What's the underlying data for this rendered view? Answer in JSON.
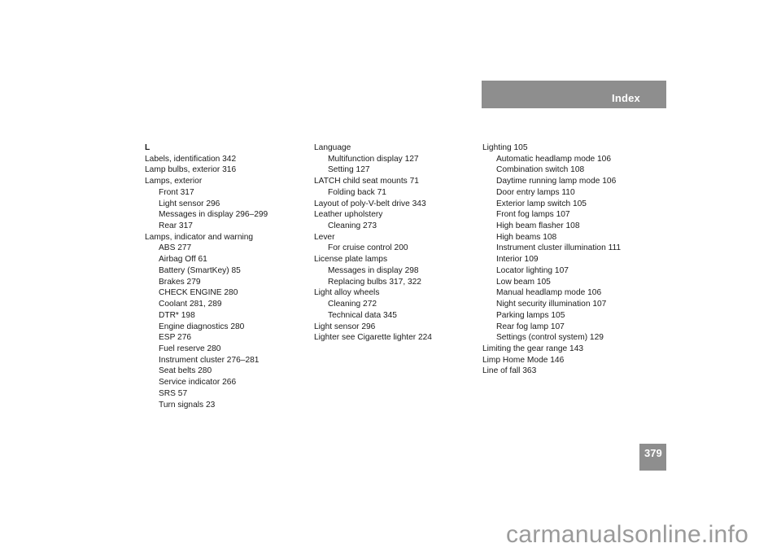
{
  "header": {
    "title": "Index"
  },
  "page_number": "379",
  "watermark": "carmanualsonline.info",
  "columns": [
    {
      "entries": [
        {
          "text": "L",
          "level": "letter"
        },
        {
          "text": "Labels, identification 342",
          "level": "main"
        },
        {
          "text": "Lamp bulbs, exterior 316",
          "level": "main"
        },
        {
          "text": "Lamps, exterior",
          "level": "main"
        },
        {
          "text": "Front 317",
          "level": "sub"
        },
        {
          "text": "Light sensor 296",
          "level": "sub"
        },
        {
          "text": "Messages in display 296–299",
          "level": "sub"
        },
        {
          "text": "Rear 317",
          "level": "sub"
        },
        {
          "text": "Lamps, indicator and warning",
          "level": "main"
        },
        {
          "text": "ABS 277",
          "level": "sub"
        },
        {
          "text": "Airbag Off 61",
          "level": "sub"
        },
        {
          "text": "Battery (SmartKey) 85",
          "level": "sub"
        },
        {
          "text": "Brakes 279",
          "level": "sub"
        },
        {
          "text": "CHECK ENGINE 280",
          "level": "sub"
        },
        {
          "text": "Coolant 281, 289",
          "level": "sub"
        },
        {
          "text": "DTR* 198",
          "level": "sub"
        },
        {
          "text": "Engine diagnostics 280",
          "level": "sub"
        },
        {
          "text": "ESP 276",
          "level": "sub"
        },
        {
          "text": "Fuel reserve 280",
          "level": "sub"
        },
        {
          "text": "Instrument cluster 276–281",
          "level": "sub"
        },
        {
          "text": "Seat belts 280",
          "level": "sub"
        },
        {
          "text": "Service indicator 266",
          "level": "sub"
        },
        {
          "text": "SRS 57",
          "level": "sub"
        },
        {
          "text": "Turn signals 23",
          "level": "sub"
        }
      ]
    },
    {
      "entries": [
        {
          "text": "Language",
          "level": "main"
        },
        {
          "text": "Multifunction display 127",
          "level": "sub"
        },
        {
          "text": "Setting 127",
          "level": "sub"
        },
        {
          "text": "LATCH child seat mounts 71",
          "level": "main"
        },
        {
          "text": "Folding back 71",
          "level": "sub"
        },
        {
          "text": "Layout of poly-V-belt drive 343",
          "level": "main"
        },
        {
          "text": "Leather upholstery",
          "level": "main"
        },
        {
          "text": "Cleaning 273",
          "level": "sub"
        },
        {
          "text": "Lever",
          "level": "main"
        },
        {
          "text": "For cruise control 200",
          "level": "sub"
        },
        {
          "text": "License plate lamps",
          "level": "main"
        },
        {
          "text": "Messages in display 298",
          "level": "sub"
        },
        {
          "text": "Replacing bulbs 317, 322",
          "level": "sub"
        },
        {
          "text": "Light alloy wheels",
          "level": "main"
        },
        {
          "text": "Cleaning 272",
          "level": "sub"
        },
        {
          "text": "Technical data 345",
          "level": "sub"
        },
        {
          "text": "Light sensor 296",
          "level": "main"
        },
        {
          "text": "Lighter see Cigarette lighter 224",
          "level": "main"
        }
      ]
    },
    {
      "entries": [
        {
          "text": "Lighting 105",
          "level": "main"
        },
        {
          "text": "Automatic headlamp mode 106",
          "level": "sub"
        },
        {
          "text": "Combination switch 108",
          "level": "sub"
        },
        {
          "text": "Daytime running lamp mode 106",
          "level": "sub"
        },
        {
          "text": "Door entry lamps 110",
          "level": "sub"
        },
        {
          "text": "Exterior lamp switch 105",
          "level": "sub"
        },
        {
          "text": "Front fog lamps 107",
          "level": "sub"
        },
        {
          "text": "High beam flasher 108",
          "level": "sub"
        },
        {
          "text": "High beams 108",
          "level": "sub"
        },
        {
          "text": "Instrument cluster illumination 111",
          "level": "sub"
        },
        {
          "text": "Interior 109",
          "level": "sub"
        },
        {
          "text": "Locator lighting 107",
          "level": "sub"
        },
        {
          "text": "Low beam 105",
          "level": "sub"
        },
        {
          "text": "Manual headlamp mode 106",
          "level": "sub"
        },
        {
          "text": "Night security illumination 107",
          "level": "sub"
        },
        {
          "text": "Parking lamps 105",
          "level": "sub"
        },
        {
          "text": "Rear fog lamp 107",
          "level": "sub"
        },
        {
          "text": "Settings (control system) 129",
          "level": "sub"
        },
        {
          "text": "Limiting the gear range 143",
          "level": "main"
        },
        {
          "text": "Limp Home Mode 146",
          "level": "main"
        },
        {
          "text": "Line of fall 363",
          "level": "main"
        }
      ]
    }
  ]
}
